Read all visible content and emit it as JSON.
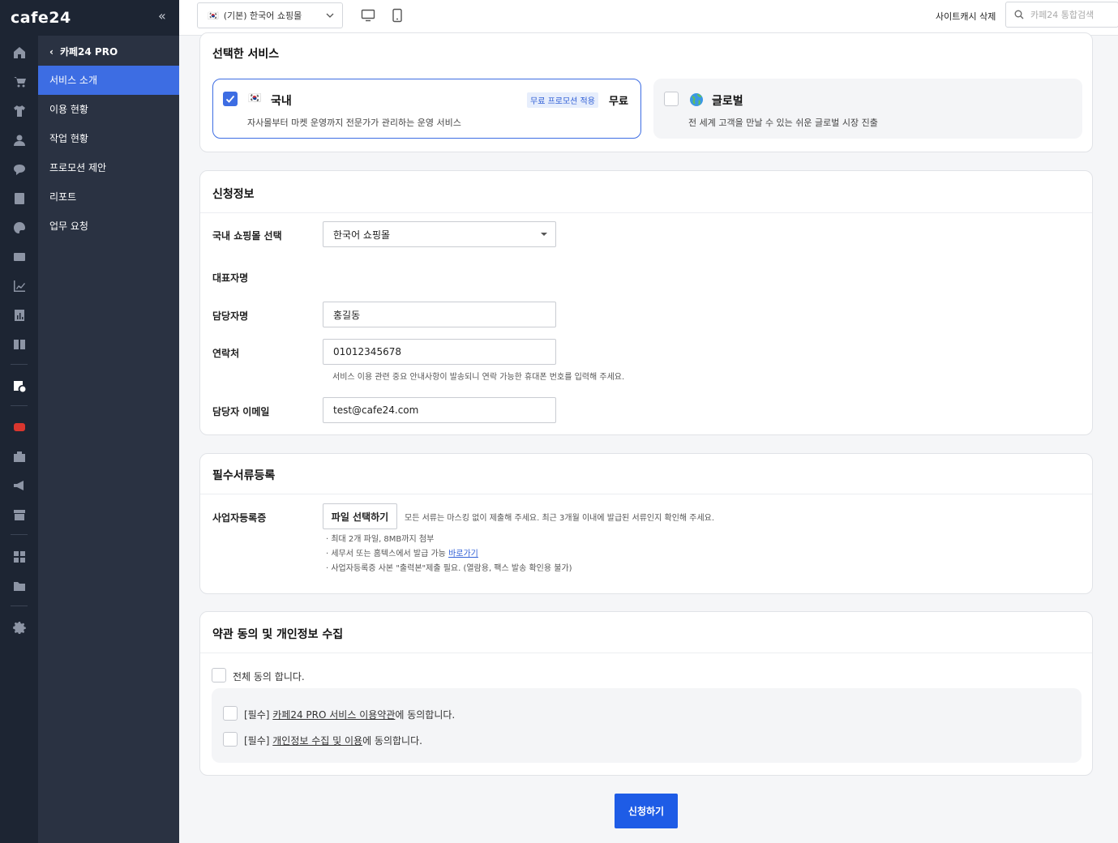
{
  "brand": {
    "logo": "cafe24",
    "accent": "#3d6de3",
    "collapse_label": "«"
  },
  "topbar": {
    "shop_select": "(기본) 한국어 쇼핑몰",
    "cache_delete": "사이트캐시 삭제",
    "search_placeholder": "카페24 통합검색"
  },
  "rail": {
    "icons": [
      "home-icon",
      "cart-icon",
      "shirt-icon",
      "user-icon",
      "chat-icon",
      "board-icon",
      "palette-icon",
      "promotion-icon",
      "stats-icon",
      "report-icon",
      "book-icon",
      "pro-service-icon",
      "youtube-icon",
      "store-icon",
      "megaphone-icon",
      "shop-icon",
      "apps-icon",
      "folder-icon",
      "settings-icon"
    ]
  },
  "submenu": {
    "back_label": "카페24 PRO",
    "items": [
      {
        "label": "서비스 소개",
        "active": true
      },
      {
        "label": "이용 현황",
        "active": false
      },
      {
        "label": "작업 현황",
        "active": false
      },
      {
        "label": "프로모션 제안",
        "active": false
      },
      {
        "label": "리포트",
        "active": false
      },
      {
        "label": "업무 요청",
        "active": false
      }
    ]
  },
  "service_section": {
    "title": "선택한 서비스",
    "domestic": {
      "name": "국내",
      "description": "자사몰부터 마켓 운영까지 전문가가 관리하는 운영 서비스",
      "badge": "무료 프로모션 적용",
      "price": "무료",
      "checked": true
    },
    "global": {
      "name": "글로벌",
      "description": "전 세계 고객을 만날 수 있는 쉬운 글로벌 시장 진출",
      "checked": false
    }
  },
  "application_section": {
    "title": "신청정보",
    "shop_label": "국내 쇼핑몰 선택",
    "shop_value": "한국어 쇼핑몰",
    "rep_label": "대표자명",
    "manager_label": "담당자명",
    "manager_value": "홍길동",
    "contact_label": "연락처",
    "contact_value": "01012345678",
    "contact_help": "서비스 이용 관련 중요 안내사항이 발송되니 연락 가능한 휴대폰 번호를 입력해 주세요.",
    "email_label": "담당자 이메일",
    "email_value": "test@cafe24.com"
  },
  "documents_section": {
    "title": "필수서류등록",
    "biz_label": "사업자등록증",
    "file_button": "파일 선택하기",
    "file_note": "모든 서류는 마스킹 없이 제출해 주세요. 최근 3개월 이내에 발급된 서류인지 확인해 주세요.",
    "bullet1": "· 최대 2개 파일, 8MB까지 첨부",
    "bullet2_prefix": "· 세무서 또는 홈텍스에서 발급 가능 ",
    "bullet2_link": "바로가기",
    "bullet3": "· 사업자등록증 사본 \"출력본\"제출 필요. (열람용, 팩스 발송 확인용 불가)"
  },
  "terms_section": {
    "title": "약관 동의 및 개인정보 수집",
    "agree_all": "전체 동의 합니다.",
    "term1_prefix": "[필수] ",
    "term1_link": "카페24 PRO 서비스 이용약관",
    "term1_suffix": "에 동의합니다.",
    "term2_prefix": "[필수] ",
    "term2_link": "개인정보 수집 및 이용",
    "term2_suffix": "에 동의합니다."
  },
  "submit_label": "신청하기"
}
